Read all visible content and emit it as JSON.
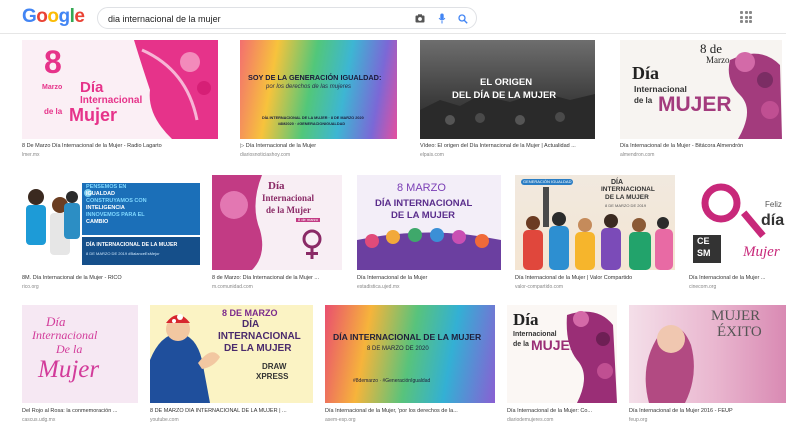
{
  "header": {
    "logo": [
      "G",
      "o",
      "o",
      "g",
      "l",
      "e"
    ],
    "logo_colors": [
      "#4285f4",
      "#ea4335",
      "#fbbc05",
      "#4285f4",
      "#34a853",
      "#ea4335"
    ],
    "query": "dia internacional de la mujer",
    "icons": {
      "camera": "camera-icon",
      "mic": "microphone-icon",
      "search": "search-icon",
      "apps": "apps-grid-icon"
    }
  },
  "results": [
    {
      "caption": "8 De Marzo Día Internacional de la Mujer - Radio Lagarto",
      "source": "lmer.mx",
      "art": {
        "num": "8",
        "t1": "Marzo",
        "t2": "Día",
        "t3": "Internacional",
        "t4": "de la",
        "t5": "Mujer"
      }
    },
    {
      "caption": "▷ Día Internacional de la Mujer",
      "source": "diariosnoticiashoy.com",
      "art": {
        "l1": "SOY DE LA GENERACIÓN IGUALDAD:",
        "l2": "por los derechos de las mujeres",
        "l3": "DÍA INTERNACIONAL DE LA MUJER · 8 DE MARZO 2020",
        "l4": "#8M2020 · #GENERACIONIGUALDAD"
      }
    },
    {
      "caption": "Vídeo: El origen del Día Internacional de la Mujer | Actualidad ...",
      "source": "elpais.com",
      "art": {
        "l1": "EL ORIGEN",
        "l2": "DEL DÍA DE LA MUJER"
      }
    },
    {
      "caption": "Día Internacional de la Mujer - Bitácora Almendrón",
      "source": "almendron.com",
      "art": {
        "l1": "8 de",
        "l2": "Marzo",
        "l3": "Día",
        "l4": "Internacional",
        "l5": "de la",
        "l6": "MUJER"
      }
    },
    {
      "caption": "8M. Día Internacional de la Mujer - RICO",
      "source": "rico.org",
      "art": {
        "l1": "PENSEMOS EN",
        "l2": "IGUALDAD",
        "l3": "CONSTRUYAMOS CON",
        "l4": "INTELIGENCIA",
        "l5": "INNOVEMOS PARA EL",
        "l6": "CAMBIO",
        "l7": "DÍA INTERNACIONAL DE LA MUJER",
        "l8": "8 DE MARZO DE 2019  #BalanceEsMejor"
      }
    },
    {
      "caption": "8 de Marzo: Día Internacional de la Mujer ...",
      "source": "m.comunidad.com",
      "art": {
        "l1": "Día",
        "l2": "Internacional",
        "l3": "de la Mujer",
        "l4": "8 de marzo"
      }
    },
    {
      "caption": "Día Internacional de la Mujer",
      "source": "estadistica.ujed.mx",
      "art": {
        "l1": "8 MARZO",
        "l2": "DÍA INTERNACIONAL",
        "l3": "DE LA MUJER"
      }
    },
    {
      "caption": "Día Internacional de la Mujer | Valor Compartido",
      "source": "valor-compartido.com",
      "art": {
        "l1": "DÍA",
        "l2": "INTERNACIONAL",
        "l3": "DE LA MUJER",
        "l4": "8 DE MARZO DE 2019",
        "badge": "GENERACIÓN IGUALDAD"
      }
    },
    {
      "caption": "Día Internacional de la Mujer ...",
      "source": "cinecom.org",
      "art": {
        "l1": "Feliz",
        "l2": "día",
        "l3": "Mujer",
        "l4": "CE",
        "l5": "SM"
      }
    },
    {
      "caption": "Del Rojo al Rosa: la conmemoración ...",
      "source": "cascus.udg.mx",
      "art": {
        "l1": "Día",
        "l2": "Internacional",
        "l3": "De la",
        "l4": "Mujer"
      }
    },
    {
      "caption": "8 DE MARZO DÍA INTERNACIONAL DE LA MUJER | ...",
      "source": "youtube.com",
      "art": {
        "l1": "8 DE MARZO",
        "l2": "DÍA",
        "l3": "INTERNACIONAL",
        "l4": "DE LA MUJER",
        "l5": "DRAW",
        "l6": "XPRESS"
      }
    },
    {
      "caption": "Día Internacional de la Mujer, 'por los derechos de la...",
      "source": "asem-esp.org",
      "art": {
        "l1": "DÍA INTERNACIONAL DE LA MUJER",
        "l2": "8 DE MARZO DE 2020",
        "l3": "#8demarzo · #GeneraciónIgualdad"
      }
    },
    {
      "caption": "Día Internacional de la Mujer: Co...",
      "source": "diariodemujeres.com",
      "art": {
        "l1": "Día",
        "l2": "Internacional",
        "l3": "de la",
        "l4": "MUJER"
      }
    },
    {
      "caption": "Día Internacional de la Mujer 2016 - FEUP",
      "source": "feup.org",
      "art": {
        "l1": "MUJER",
        "l2": "ÉXITO"
      }
    }
  ]
}
